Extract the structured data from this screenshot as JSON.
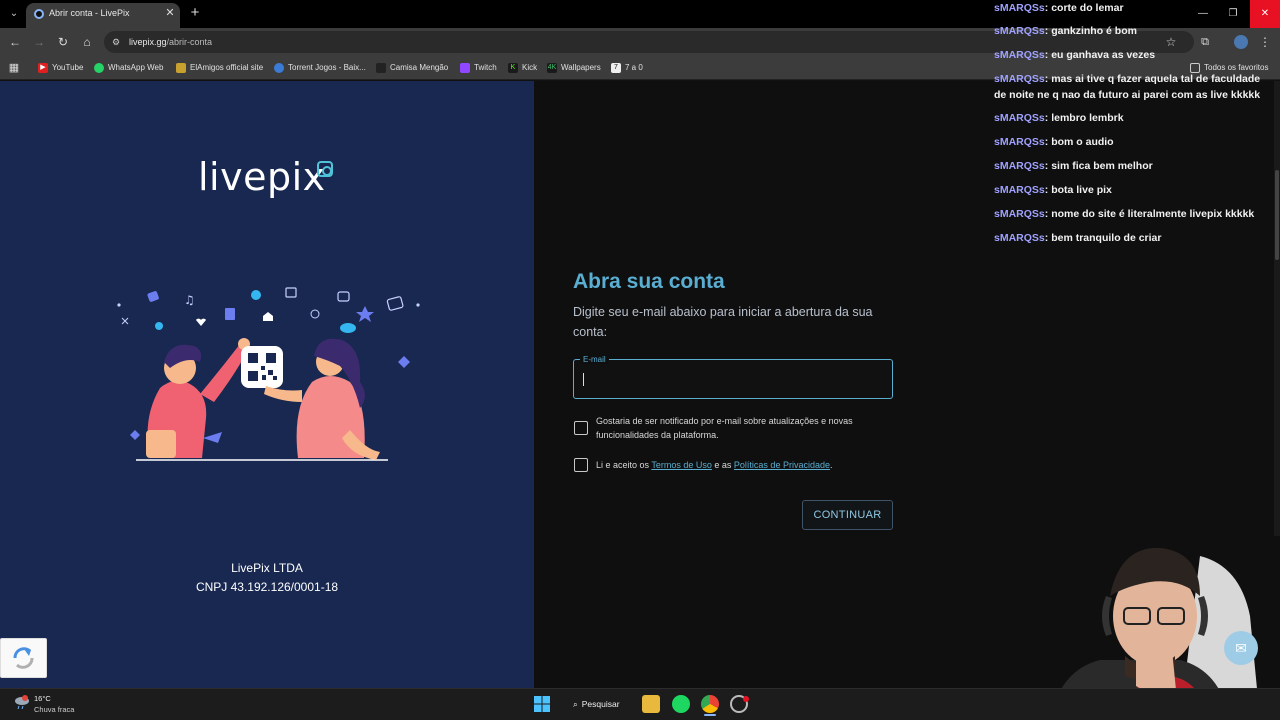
{
  "browser": {
    "tab_title": "Abrir conta - LivePix",
    "url_domain": "livepix.gg",
    "url_path": "/abrir-conta",
    "bookmarks": [
      "YouTube",
      "WhatsApp Web",
      "ElAmigos official site",
      "Torrent Jogos - Baix...",
      "Camisa Mengão",
      "Twitch",
      "Kick",
      "Wallpapers",
      "7 a 0"
    ],
    "all_bookmarks_label": "Todos os favoritos"
  },
  "brand": {
    "logo": "livepix",
    "company_name": "LivePix LTDA",
    "company_cnpj": "CNPJ 43.192.126/0001-18"
  },
  "form": {
    "title": "Abra sua conta",
    "subtitle": "Digite seu e-mail abaixo para iniciar a abertura da sua conta:",
    "email_label": "E-mail",
    "email_value": "",
    "notify_label": "Gostaria de ser notificado por e-mail sobre atualizações e novas funcionalidades da plataforma.",
    "terms_prefix": "Li e aceito os ",
    "terms_link": "Termos de Uso",
    "terms_mid": " e as ",
    "privacy_link": "Políticas de Privacidade",
    "terms_suffix": ".",
    "notify_checked": false,
    "terms_checked": false,
    "continue_label": "CONTINUAR"
  },
  "chat": [
    {
      "user": "sMARQSs",
      "msg": "corte do lemar"
    },
    {
      "user": "sMARQSs",
      "msg": "gankzinho é bom"
    },
    {
      "user": "sMARQSs",
      "msg": "eu ganhava as vezes"
    },
    {
      "user": "sMARQSs",
      "msg": "mas ai tive q fazer aquela tal de faculdade de noite ne q nao da futuro ai parei com as live kkkkk"
    },
    {
      "user": "sMARQSs",
      "msg": "lembro lembrk"
    },
    {
      "user": "sMARQSs",
      "msg": "bom o audio"
    },
    {
      "user": "sMARQSs",
      "msg": "sim fica bem melhor"
    },
    {
      "user": "sMARQSs",
      "msg": "bota live pix"
    },
    {
      "user": "sMARQSs",
      "msg": "nome do site é literalmente livepix kkkkk"
    },
    {
      "user": "sMARQSs",
      "msg": "bem tranquilo de criar"
    }
  ],
  "taskbar": {
    "weather_temp": "16°C",
    "weather_desc": "Chuva fraca",
    "search_label": "Pesquisar"
  },
  "colors": {
    "left_panel": "#182850",
    "accent": "#5aaed1",
    "chat_user": "#9fa2ff"
  }
}
